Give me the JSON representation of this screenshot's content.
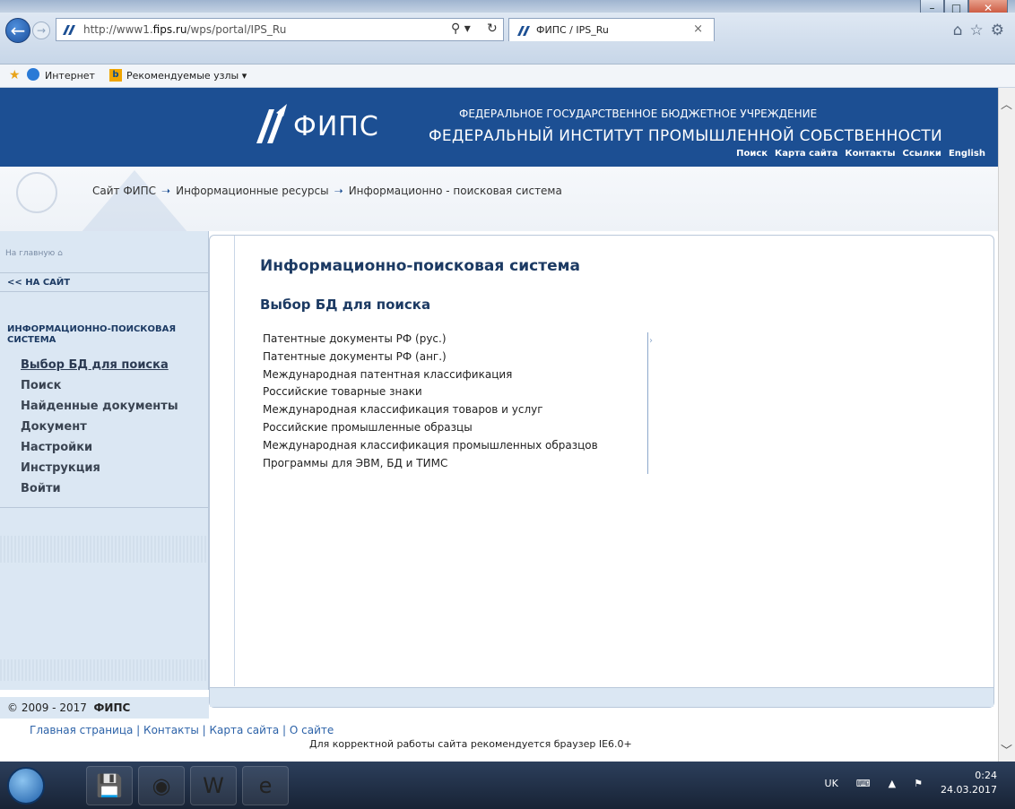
{
  "browser": {
    "url_prefix": "http://www1.",
    "url_host": "fips.ru",
    "url_path": "/wps/portal/IPS_Ru",
    "tab_title": "ФИПС / IPS_Ru",
    "favorites": {
      "internet": "Интернет",
      "recommended": "Рекомендуемые узлы ▾"
    }
  },
  "header": {
    "logo": "ФИПС",
    "line1": "ФЕДЕРАЛЬНОЕ ГОСУДАРСТВЕННОЕ БЮДЖЕТНОЕ УЧРЕЖДЕНИЕ",
    "line2": "ФЕДЕРАЛЬНЫЙ ИНСТИТУТ ПРОМЫШЛЕННОЙ СОБСТВЕННОСТИ",
    "links": [
      "Поиск",
      "Карта сайта",
      "Контакты",
      "Ссылки",
      "English"
    ]
  },
  "breadcrumb": [
    "Сайт ФИПС",
    "Информационные ресурсы",
    "Информационно - поисковая система"
  ],
  "sidebar": {
    "home": "На главную",
    "back": "<< НА САЙТ",
    "section": "ИНФОРМАЦИОННО-ПОИСКОВАЯ СИСТЕМА",
    "items": [
      {
        "label": "Выбор БД для поиска",
        "active": true
      },
      {
        "label": "Поиск"
      },
      {
        "label": "Найденные документы"
      },
      {
        "label": "Документ"
      },
      {
        "label": "Настройки"
      },
      {
        "label": "Инструкция"
      },
      {
        "label": "Войти"
      }
    ]
  },
  "main": {
    "title": "Информационно-поисковая система",
    "subtitle": "Выбор БД для поиска",
    "databases": [
      "Патентные документы РФ (рус.)",
      "Патентные документы РФ (анг.)",
      "Международная патентная классификация",
      "Российские товарные знаки",
      "Международная классификация товаров и услуг",
      "Российские промышленные образцы",
      "Международная классификация промышленных образцов",
      "Программы для ЭВМ, БД и ТИМС"
    ]
  },
  "footer": {
    "copyright_years": "© 2009 - 2017",
    "copyright_org": "ФИПС",
    "links": "Главная страница | Контакты | Карта сайта | О сайте",
    "note": "Для корректной работы сайта рекомендуется браузер IE6.0+"
  },
  "taskbar": {
    "lang": "UK",
    "time": "0:24",
    "date": "24.03.2017"
  }
}
